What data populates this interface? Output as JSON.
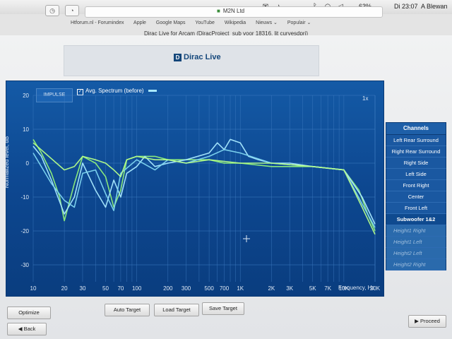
{
  "menubar": {
    "battery": "63%",
    "time": "Di 23:07",
    "user": "A Blewan"
  },
  "browser": {
    "url": "M2N Ltd",
    "bookmarks": [
      "Htforum.nl - Forumindex",
      "Apple",
      "Google Maps",
      "YouTube",
      "Wikipedia",
      "Nieuws ⌄",
      "Populair ⌄"
    ],
    "tab_title": "Dirac Live for Arcam (DiracProject_sub voor 18316. lit curvesdprj)"
  },
  "logo": {
    "brand": "Dirac Live"
  },
  "graph": {
    "impulse_tab": "IMPULSE",
    "legend_label": "Avg. Spectrum (before)",
    "zoom": "1x",
    "y_axis_label": "Normalized level, dB",
    "x_axis_label": "Frequency, Hz",
    "y_ticks": [
      "20",
      "10",
      "0",
      "-10",
      "-20",
      "-30"
    ],
    "x_ticks": [
      "10",
      "20",
      "30",
      "50",
      "70",
      "100",
      "200",
      "300",
      "500",
      "700",
      "1K",
      "2K",
      "3K",
      "5K",
      "7K",
      "10K",
      "20K"
    ]
  },
  "chart_data": {
    "type": "line",
    "xscale": "log",
    "xlim": [
      10,
      20000
    ],
    "ylim": [
      -35,
      20
    ],
    "xlabel": "Frequency, Hz",
    "ylabel": "Normalized level, dB",
    "grid": true,
    "series": [
      {
        "color": "#8ff07a",
        "x": [
          10,
          12,
          15,
          18,
          20,
          25,
          30,
          40,
          50,
          60,
          70,
          80,
          100,
          150,
          200,
          300,
          500,
          700,
          1000,
          2000,
          3000,
          5000,
          10000,
          14000,
          17000,
          20000
        ],
        "y": [
          7,
          3,
          -3,
          -10,
          -17,
          -6,
          2,
          0,
          -4,
          -13,
          -8,
          1,
          2,
          2,
          1,
          1,
          1,
          0,
          0,
          -1,
          -1,
          -1,
          -2,
          -8,
          -15,
          -20
        ]
      },
      {
        "color": "#a9e9ff",
        "x": [
          10,
          12,
          15,
          20,
          25,
          30,
          40,
          50,
          60,
          70,
          80,
          100,
          120,
          150,
          200,
          300,
          500,
          600,
          700,
          800,
          1000,
          1200,
          1500,
          2000,
          3000,
          5000,
          10000,
          15000,
          20000
        ],
        "y": [
          5,
          2,
          -5,
          -15,
          -10,
          0,
          -8,
          -13,
          -5,
          -10,
          -3,
          -1,
          2,
          -1,
          0,
          1,
          3,
          6,
          4,
          7,
          6,
          2,
          1,
          0,
          0,
          -1,
          -2,
          -10,
          -18
        ]
      },
      {
        "color": "#7fd6f0",
        "x": [
          10,
          15,
          20,
          25,
          30,
          40,
          50,
          60,
          70,
          100,
          150,
          200,
          300,
          500,
          700,
          1000,
          2000,
          5000,
          10000,
          15000,
          20000
        ],
        "y": [
          3,
          -6,
          -11,
          -13,
          -3,
          -2,
          -9,
          -14,
          -3,
          1,
          -2,
          1,
          0,
          2,
          4,
          3,
          0,
          -1,
          -2,
          -12,
          -19
        ]
      },
      {
        "color": "#b6ff88",
        "x": [
          10,
          20,
          25,
          30,
          40,
          50,
          60,
          70,
          80,
          100,
          150,
          200,
          300,
          500,
          1000,
          2000,
          5000,
          10000,
          15000,
          20000
        ],
        "y": [
          6,
          -2,
          -1,
          2,
          1,
          0,
          -2,
          -4,
          1,
          2,
          1,
          1,
          0,
          1,
          0,
          0,
          -1,
          -2,
          -13,
          -21
        ]
      }
    ]
  },
  "channels": {
    "header": "Channels",
    "items": [
      "Left Rear Surround",
      "Right Rear Surround",
      "Right Side",
      "Left Side",
      "Front Right",
      "Center",
      "Front Left"
    ],
    "subwoofer": "Subwoofer 1&2",
    "disabled": [
      "Height1 Right",
      "Height1 Left",
      "Height2 Left",
      "Height2 Right"
    ]
  },
  "buttons": {
    "optimize": "Optimize",
    "auto_target": "Auto Target",
    "load_target": "Load Target",
    "save_target": "Save Target",
    "back": "Back",
    "proceed": "Proceed"
  }
}
